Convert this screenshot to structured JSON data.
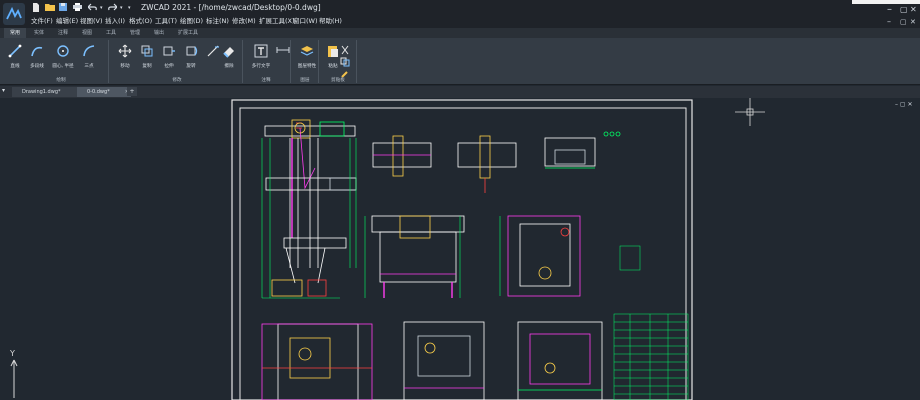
{
  "app": {
    "title": "ZWCAD 2021 - [/home/zwcad/Desktop/0-0.dwg]",
    "menus": [
      "文件(F)",
      "编辑(E)",
      "视图(V)",
      "插入(I)",
      "格式(O)",
      "工具(T)",
      "绘图(D)",
      "标注(N)",
      "修改(M)",
      "扩展工具(X)",
      "窗口(W)",
      "帮助(H)"
    ],
    "window_controls": [
      "–",
      "▢",
      "✕"
    ]
  },
  "ribbon": {
    "tabs": [
      "常用",
      "实体",
      "注释",
      "视图",
      "工具",
      "管理",
      "输出",
      "扩展工具"
    ],
    "tools": [
      {
        "label": "直线",
        "icon": "line-icon"
      },
      {
        "label": "多段线",
        "icon": "polyline-icon"
      },
      {
        "label": "圆心, 半径",
        "icon": "circle-icon"
      },
      {
        "label": "三点",
        "icon": "arc-icon"
      },
      {
        "label": "移动",
        "icon": "move-icon"
      },
      {
        "label": "复制",
        "icon": "copy-icon"
      },
      {
        "label": "拉伸",
        "icon": "stretch-icon"
      },
      {
        "label": "旋转",
        "icon": "rotate-icon"
      },
      {
        "label": "擦除",
        "icon": "erase-icon"
      },
      {
        "label": "多行文字",
        "icon": "mtext-icon"
      },
      {
        "label": "图层特性",
        "icon": "layers-icon"
      },
      {
        "label": "粘贴",
        "icon": "paste-icon"
      }
    ],
    "groups": [
      "绘制",
      "修改",
      "注释",
      "图层",
      "剪贴板"
    ]
  },
  "doc_tabs": [
    {
      "label": "Drawing1.dwg*",
      "active": false
    },
    {
      "label": "0-0.dwg*",
      "active": true
    }
  ],
  "canvas": {
    "background": "#212830",
    "ucs_y_label": "Y"
  }
}
